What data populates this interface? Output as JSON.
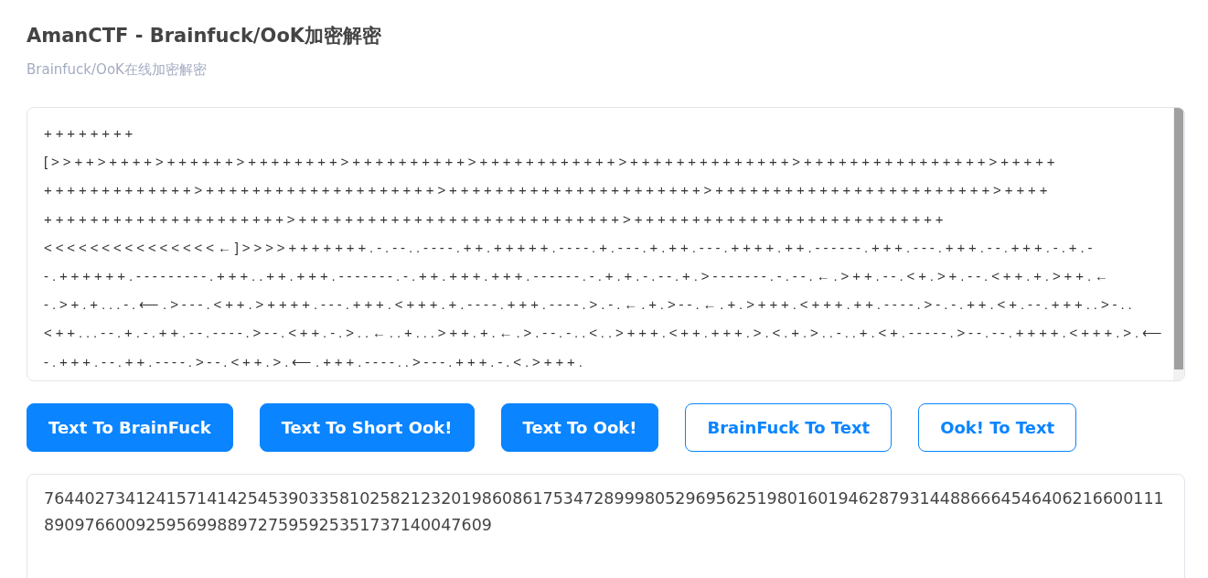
{
  "title": "AmanCTF - Brainfuck/OoK加密解密",
  "subtitle": "Brainfuck/OoK在线加密解密",
  "input": {
    "lines": [
      "++++++++",
      "[>>++>++++>++++++>++++++++>++++++++++>++++++++++++>++++++++++++++>++++++++++++++++>+++++",
      "+++++++++++++>++++++++++++++++++++>++++++++++++++++++++++>++++++++++++++++++++++++>++++",
      "+++++++++++++++++++++>++++++++++++++++++++++++++++>+++++++++++++++++++++++++++",
      "<<<<<<<<<<<<<<<←]>>>>+++++++.-.--..----.++.+++++.----.+.---.+.++.---.++++.++.------.+++.---.+++.--.+++.-.+.-",
      "-.++++++.---------.+++..++.+++.-------.-.++.+++.+++.------.-.+.+.-.--.+.>-------.-.--.←.>++.--.<+.>+.--.<++.+.>++.←",
      "-.>+.+...-.⟵.>---.<++.>++++.---.+++.<+++.+.----.+++.----.>.-.←.+.>--.←.+.>+++.<+++.++.----.>-.-.++.<+.--.+++..>-..",
      "<++...--.+.-.++.--.----.>--.<++.-.>..←..+...>++.+.←.>.--.-..<..>+++.<++.+++.>.<.+.>..-..+.<+.-----.>--.--.++++.<+++.>.⟵",
      "-.+++.--.++.----.>--.<++.>.⟵.+++.----..>---.+++.-.<.>+++."
    ]
  },
  "buttons": [
    {
      "label": "Text To BrainFuck",
      "kind": "primary"
    },
    {
      "label": "Text To Short Ook!",
      "kind": "primary"
    },
    {
      "label": "Text To Ook!",
      "kind": "primary"
    },
    {
      "label": "BrainFuck To Text",
      "kind": "outline"
    },
    {
      "label": "Ook! To Text",
      "kind": "outline"
    }
  ],
  "output": {
    "value": "7644027341241571414254539033581025821232019860861753472899980529695625198016019462879314488666454640621660011189097660092595699889727595925351737140047609"
  }
}
